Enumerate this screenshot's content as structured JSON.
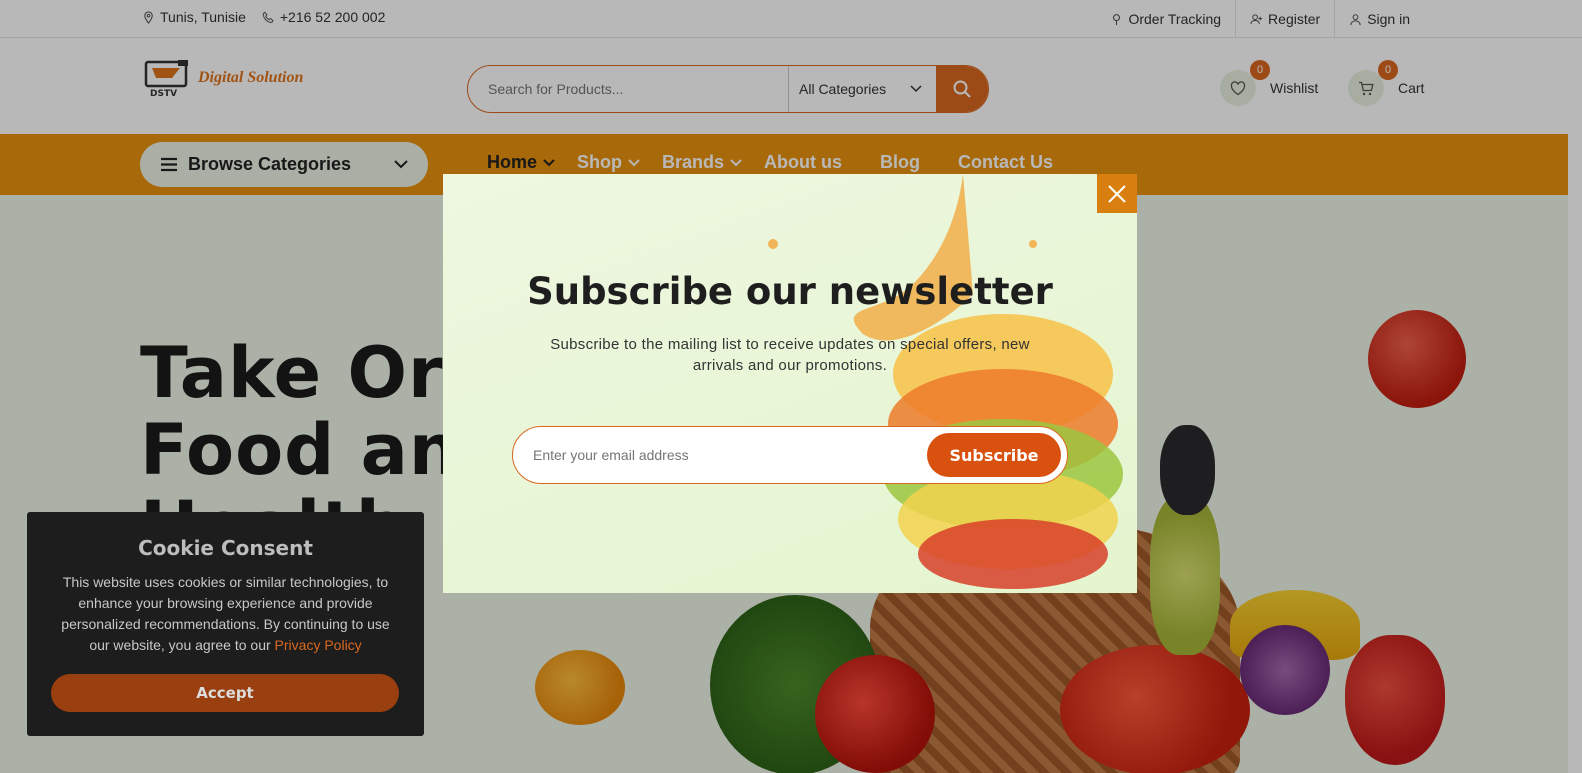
{
  "topbar": {
    "location": "Tunis, Tunisie",
    "phone": "+216 52 200 002",
    "order_tracking": "Order Tracking",
    "register": "Register",
    "sign_in": "Sign in"
  },
  "header": {
    "logo_text": "Digital Solution",
    "logo_mark_text": "DSTV",
    "search_placeholder": "Search for Products...",
    "category_selected": "All Categories",
    "wishlist_label": "Wishlist",
    "wishlist_count": "0",
    "cart_label": "Cart",
    "cart_count": "0"
  },
  "nav": {
    "browse_label": "Browse Categories",
    "items": [
      {
        "label": "Home"
      },
      {
        "label": "Shop"
      },
      {
        "label": "Brands"
      },
      {
        "label": "About us"
      },
      {
        "label": "Blog"
      },
      {
        "label": "Contact Us"
      }
    ]
  },
  "hero": {
    "line1": "Take Org",
    "line2": "Food and",
    "line3": "Health"
  },
  "newsletter": {
    "title": "Subscribe our newsletter",
    "description": "Subscribe to the mailing list to receive updates on special offers, new arrivals and our promotions.",
    "email_placeholder": "Enter your email address",
    "subscribe_label": "Subscribe"
  },
  "cookie": {
    "title": "Cookie Consent",
    "text": "This website uses cookies or similar technologies, to enhance your browsing experience and provide personalized recommendations. By continuing to use our website, you agree to our",
    "link": "Privacy Policy",
    "accept_label": "Accept"
  },
  "colors": {
    "brand_orange": "#d9681f",
    "nav_bar": "#e8920d",
    "hero_bg": "#eef5e6"
  }
}
